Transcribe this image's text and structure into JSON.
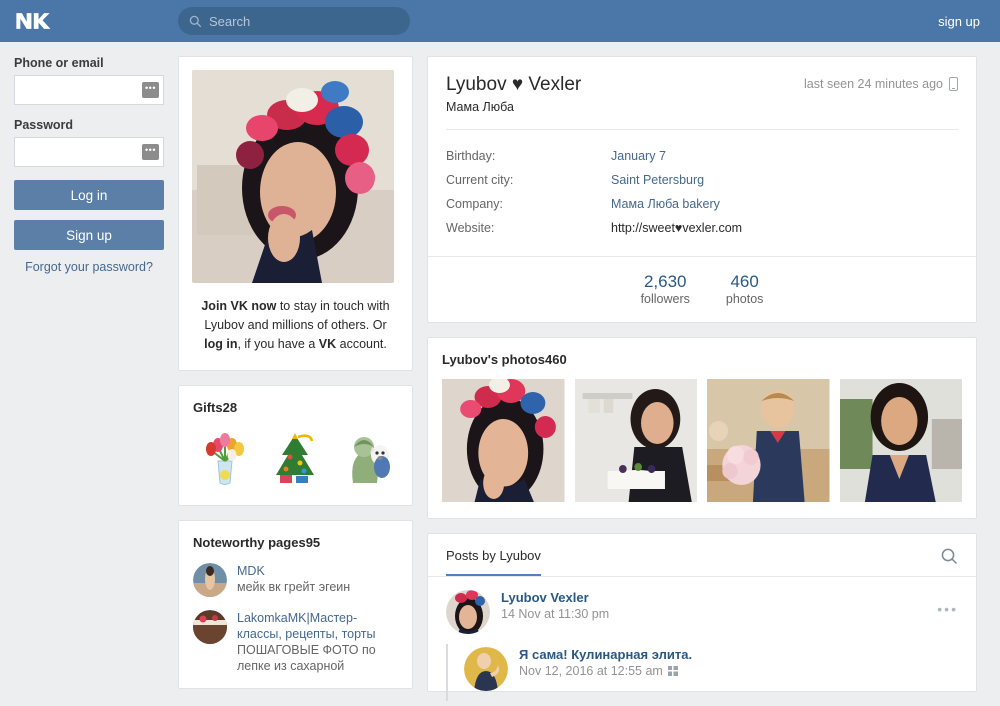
{
  "topbar": {
    "logo_name": "vk-logo",
    "search_placeholder": "Search",
    "search_value": "",
    "signup_label": "sign up"
  },
  "login": {
    "phone_label": "Phone or email",
    "phone_value": "",
    "password_label": "Password",
    "password_value": "",
    "badge_glyph": "•••",
    "login_button": "Log in",
    "signup_button": "Sign up",
    "forgot_link": "Forgot your password?"
  },
  "avatar_card": {
    "join_lead": "Join VK now",
    "join_mid": " to stay in touch with Lyubov and millions of others. Or ",
    "join_login": "log in",
    "join_tail": ", if you have a ",
    "join_vk": "VK",
    "join_end": " account."
  },
  "gifts": {
    "title": "Gifts",
    "count": "28",
    "items": [
      "tulip-bouquet-gift",
      "christmas-tree-gift",
      "doll-with-dog-gift"
    ]
  },
  "noteworthy": {
    "title": "Noteworthy pages",
    "count": "95",
    "items": [
      {
        "name": "MDK",
        "desc": "мейк вк грейт эгеин"
      },
      {
        "name": "LakomkaMK|Мастер-классы, рецепты, торты",
        "desc": "ПОШАГОВЫЕ ФОТО по лепке из сахарной"
      }
    ]
  },
  "profile": {
    "name": "Lyubov ♥ Vexler",
    "status": "Мама Люба",
    "last_seen": "last seen 24 minutes ago",
    "last_seen_icon": "mobile-phone-icon",
    "info": [
      {
        "key": "Birthday:",
        "value": "January 7",
        "style": "link"
      },
      {
        "key": "Current city:",
        "value": "Saint Petersburg",
        "style": "link"
      },
      {
        "key": "Company:",
        "value": "Мама Люба bakery",
        "style": "link"
      },
      {
        "key": "Website:",
        "value": "http://sweet♥vexler.com",
        "style": "plain"
      }
    ],
    "counts": [
      {
        "num": "2,630",
        "label": "followers"
      },
      {
        "num": "460",
        "label": "photos"
      }
    ]
  },
  "photos": {
    "title": "Lyubov's photos",
    "count": "460",
    "items": [
      "photo-flower-crown",
      "photo-holding-cake",
      "photo-boy-with-roses",
      "photo-navy-dress"
    ]
  },
  "posts": {
    "tab_label": "Posts by Lyubov",
    "search_icon": "search-icon",
    "items": [
      {
        "author": "Lyubov Vexler",
        "date": "14 Nov at 11:30 pm",
        "platform_icon": "",
        "indented": false
      },
      {
        "author": "Я сама! Кулинарная элита.",
        "date": "Nov 12, 2016 at 12:55 am",
        "platform_icon": "windows-icon",
        "indented": true
      }
    ]
  },
  "colors": {
    "brand": "#4a76a8",
    "link": "#45688e",
    "page_bg": "#edeef0",
    "accent_tab": "#5181b8"
  }
}
